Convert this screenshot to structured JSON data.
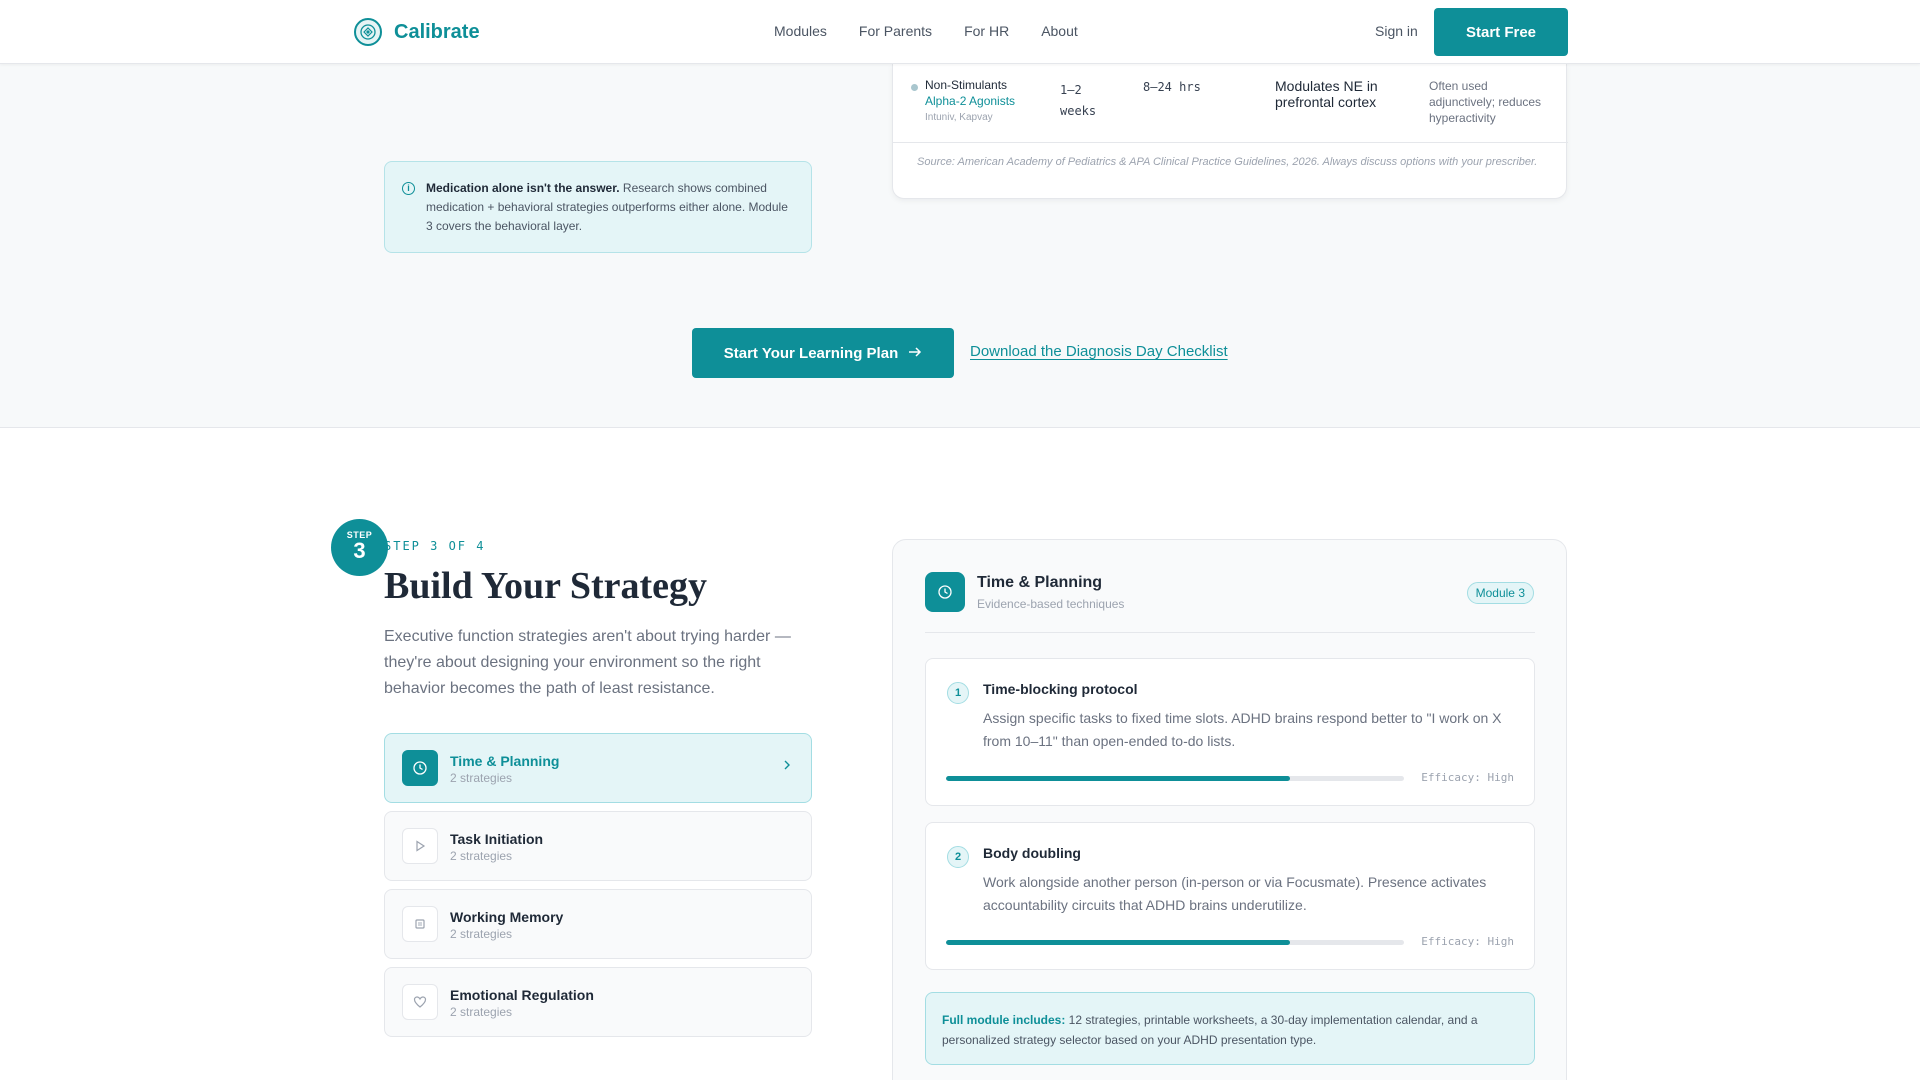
{
  "nav": {
    "brand": "Calibrate",
    "links": [
      "Modules",
      "For Parents",
      "For HR",
      "About"
    ],
    "signin": "Sign in",
    "start_free": "Start Free"
  },
  "callout": {
    "bold": "Medication alone isn't the answer.",
    "text": " Research shows combined medication + behavioral strategies outperforms either alone. Module 3 covers the behavioral layer."
  },
  "med_table": {
    "row": {
      "class": "Non-Stimulants",
      "subclass": "Alpha-2 Agonists",
      "brands": "Intuniv, Kapvay",
      "onset": "1–2 weeks",
      "duration": "8–24 hrs",
      "mechanism": "Modulates NE in prefrontal cortex",
      "notes": "Often used adjunctively; reduces hyperactivity"
    },
    "source": "Source: American Academy of Pediatrics & APA Clinical Practice Guidelines, 2026. Always discuss options with your prescriber."
  },
  "cta": {
    "primary": "Start Your Learning Plan",
    "secondary": "Download the Diagnosis Day Checklist"
  },
  "step": {
    "badge_word": "STEP",
    "badge_num": "3",
    "label": "STEP 3 OF 4",
    "title": "Build Your Strategy",
    "description": "Executive function strategies aren't about trying harder — they're about designing your environment so the right behavior becomes the path of least resistance."
  },
  "categories": [
    {
      "name": "Time & Planning",
      "sub": "2 strategies",
      "icon": "clock-icon",
      "active": true
    },
    {
      "name": "Task Initiation",
      "sub": "2 strategies",
      "icon": "play-icon",
      "active": false
    },
    {
      "name": "Working Memory",
      "sub": "2 strategies",
      "icon": "chip-icon",
      "active": false
    },
    {
      "name": "Emotional Regulation",
      "sub": "2 strategies",
      "icon": "heart-icon",
      "active": false
    }
  ],
  "panel": {
    "title": "Time & Planning",
    "subtitle": "Evidence-based techniques",
    "badge": "Module 3",
    "strategies": [
      {
        "num": "1",
        "title": "Time-blocking protocol",
        "desc": "Assign specific tasks to fixed time slots. ADHD brains respond better to \"I work on X from 10–11\" than open-ended to-do lists.",
        "efficacy": "Efficacy: High",
        "level": 0.75
      },
      {
        "num": "2",
        "title": "Body doubling",
        "desc": "Work alongside another person (in-person or via Focusmate). Presence activates accountability circuits that ADHD brains underutilize.",
        "efficacy": "Efficacy: High",
        "level": 0.75
      }
    ],
    "full_module": {
      "bold": "Full module includes:",
      "text": " 12 strategies, printable worksheets, a 30-day implementation calendar, and a personalized strategy selector based on your ADHD presentation type."
    }
  },
  "colors": {
    "accent": "#0e8f98",
    "accent_light": "#e4f5f7"
  }
}
